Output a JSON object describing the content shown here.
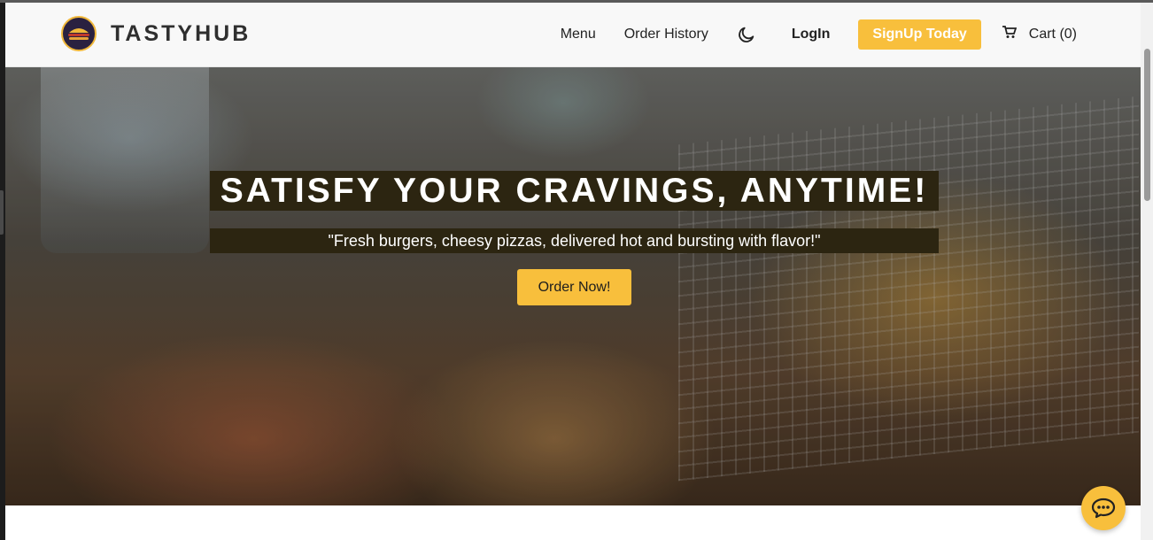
{
  "brand": {
    "name": "TASTYHUB",
    "logo_icon": "burger-logo-icon"
  },
  "nav": {
    "menu": "Menu",
    "order_history": "Order History",
    "theme_icon": "moon-icon",
    "login": "LogIn",
    "signup": "SignUp Today",
    "cart_icon": "cart-icon",
    "cart": "Cart (0)"
  },
  "hero": {
    "title": "SATISFY YOUR CRAVINGS, ANYTIME!",
    "subtitle": "\"Fresh burgers, cheesy pizzas, delivered hot and bursting with flavor!\"",
    "cta": "Order Now!"
  },
  "chat": {
    "icon": "chat-bubble-icon"
  },
  "colors": {
    "accent": "#f8bf3c",
    "title_bg": "#2c2511",
    "nav_bg": "#f8f8f8"
  }
}
